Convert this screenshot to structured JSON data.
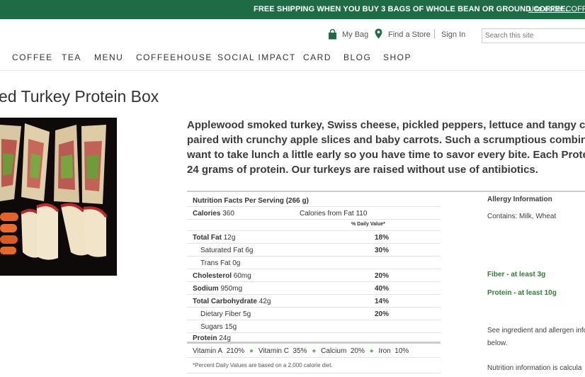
{
  "promo": {
    "message": "FREE SHIPPING WHEN YOU BUY 3 BAGS OF WHOLE BEAN OR GROUND COFFEE.",
    "code_text": "Use code: COFFEE"
  },
  "utility": {
    "bag": "My Bag",
    "store": "Find a Store",
    "signin": "Sign In",
    "search_placeholder": "Search this site"
  },
  "nav": [
    "COFFEE",
    "TEA",
    "MENU",
    "COFFEEHOUSE",
    "SOCIAL IMPACT",
    "CARD",
    "BLOG",
    "SHOP"
  ],
  "product": {
    "title": "ed Turkey Protein Box",
    "description_lines": [
      "Applewood smoked turkey, Swiss cheese, pickled peppers, lettuce and tangy cream chees",
      "paired with crunchy apple slices and baby carrots. Such a scrumptious combination, you m",
      "want to take lunch a little early so you have time to savor every bite. Each Protein Box co",
      "24 grams of protein. Our turkeys are raised without use of antibiotics."
    ]
  },
  "nutrition": {
    "header": "Nutrition Facts Per Serving (266 g)",
    "calories_label": "Calories",
    "calories_value": "360",
    "fat_calories": "Calories from Fat 110",
    "daily_value_header": "% Daily Value*",
    "rows": [
      {
        "label": "Total Fat",
        "amount": "12g",
        "pct": "18%"
      },
      {
        "label": "Saturated Fat",
        "amount": "6g",
        "pct": "30%"
      },
      {
        "label": "Trans Fat",
        "amount": "0g",
        "pct": ""
      },
      {
        "label": "Cholesterol",
        "amount": "60mg",
        "pct": "20%"
      },
      {
        "label": "Sodium",
        "amount": "950mg",
        "pct": "40%"
      },
      {
        "label": "Total Carbohydrate",
        "amount": "42g",
        "pct": "14%"
      },
      {
        "label": "Dietary Fiber",
        "amount": "5g",
        "pct": "20%"
      },
      {
        "label": "Sugars",
        "amount": "15g",
        "pct": ""
      },
      {
        "label": "Protein",
        "amount": "24g",
        "pct": ""
      }
    ],
    "vitamins": [
      {
        "name": "Vitamin A",
        "pct": "210%"
      },
      {
        "name": "Vitamin C",
        "pct": "35%"
      },
      {
        "name": "Calcium",
        "pct": "20%"
      },
      {
        "name": "Iron",
        "pct": "10%"
      }
    ],
    "footnote": "*Percent Daily Values are based on a 2,000 calorie diet."
  },
  "allergy": {
    "title": "Allergy Information",
    "contains": "Contains: Milk, Wheat",
    "fiber": "Fiber - at least 3g",
    "protein": "Protein - at least 10g",
    "see_line1": "See ingredient and allergen info",
    "see_line2": "below.",
    "calc": "Nutrition information is calcula"
  },
  "colors": {
    "brand_green": "#1e6b45",
    "accent_green": "#2e7d32",
    "bullet_green": "#6fb26f"
  }
}
